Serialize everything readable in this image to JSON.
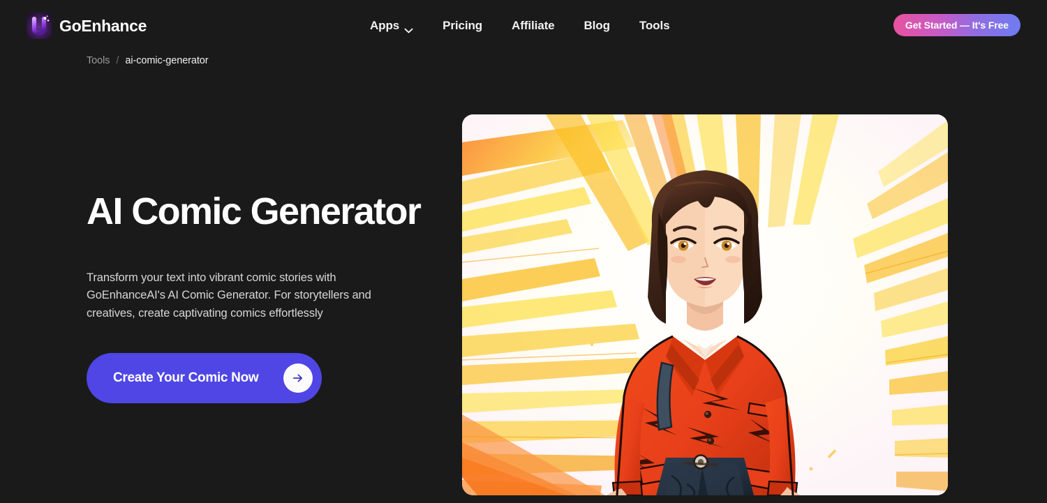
{
  "header": {
    "brand": {
      "name": "GoEnhance",
      "logo_icon": "goenhance-u-logo-icon"
    },
    "nav": [
      {
        "label": "Apps",
        "has_dropdown": true,
        "icon": "chevron-down-icon"
      },
      {
        "label": "Pricing",
        "has_dropdown": false
      },
      {
        "label": "Affiliate",
        "has_dropdown": false
      },
      {
        "label": "Blog",
        "has_dropdown": false
      },
      {
        "label": "Tools",
        "has_dropdown": false
      }
    ],
    "cta": {
      "label": "Get Started — It's Free"
    }
  },
  "breadcrumb": {
    "parent": "Tools",
    "separator": "/",
    "current": "ai-comic-generator"
  },
  "hero": {
    "headline": "AI Comic Generator",
    "description": "Transform your text into vibrant comic stories with GoEnhanceAI's AI Comic Generator. For storytellers and creatives, create captivating comics effortlessly",
    "cta": {
      "label": "Create Your Comic Now",
      "icon": "arrow-right-icon"
    },
    "image_alt": "Anime-style illustration of a woman with a dark bob haircut wearing a red blazer and dark jeans, standing against radiating yellow and orange comic speed lines on a white background"
  },
  "colors": {
    "page_background": "#1a1a1a",
    "text_primary": "#ffffff",
    "text_secondary": "#d6d6d6",
    "text_muted": "#9b9b9b",
    "cta_primary": "#4f46e5",
    "cta_gradient_start": "#e8529f",
    "cta_gradient_end": "#6f7cf0",
    "logo_purple": "#a855f7"
  }
}
